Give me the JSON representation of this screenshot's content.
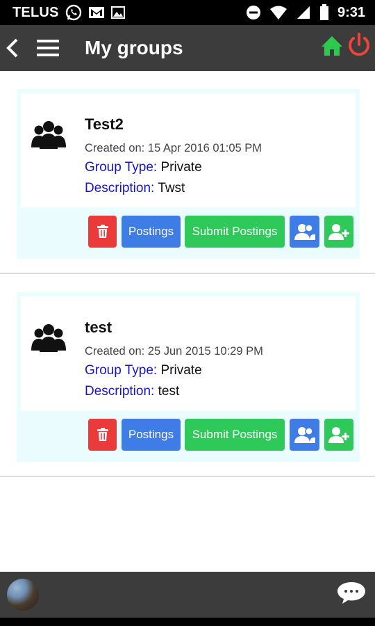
{
  "status_bar": {
    "carrier": "TELUS",
    "time": "9:31"
  },
  "header": {
    "title": "My groups"
  },
  "groups": [
    {
      "name": "Test2",
      "created": "Created on: 15 Apr 2016 01:05 PM",
      "type_label": "Group Type:",
      "type_value": "Private",
      "desc_label": "Description:",
      "desc_value": "Twst",
      "postings_label": "Postings",
      "submit_label": "Submit Postings"
    },
    {
      "name": "test",
      "created": "Created on: 25 Jun 2015 10:29 PM",
      "type_label": "Group Type:",
      "type_value": "Private",
      "desc_label": "Description:",
      "desc_value": "test",
      "postings_label": "Postings",
      "submit_label": "Submit Postings"
    }
  ],
  "icons": {
    "back": "back-arrow-icon",
    "menu": "hamburger-menu-icon",
    "home": "home-icon",
    "power": "power-icon",
    "group": "group-icon",
    "delete": "trash-icon",
    "members": "members-icon",
    "add_user": "add-user-icon",
    "chat": "chat-bubble-icon"
  },
  "colors": {
    "app_bar": "#3c3c3c",
    "home_green": "#2ec94f",
    "power_red": "#ef4438",
    "delete_red": "#ea3a3a",
    "primary_blue": "#3e7ce6",
    "success_green": "#2fc95a",
    "label_blue": "#1a14c8",
    "card_bg": "#eafcfe"
  }
}
